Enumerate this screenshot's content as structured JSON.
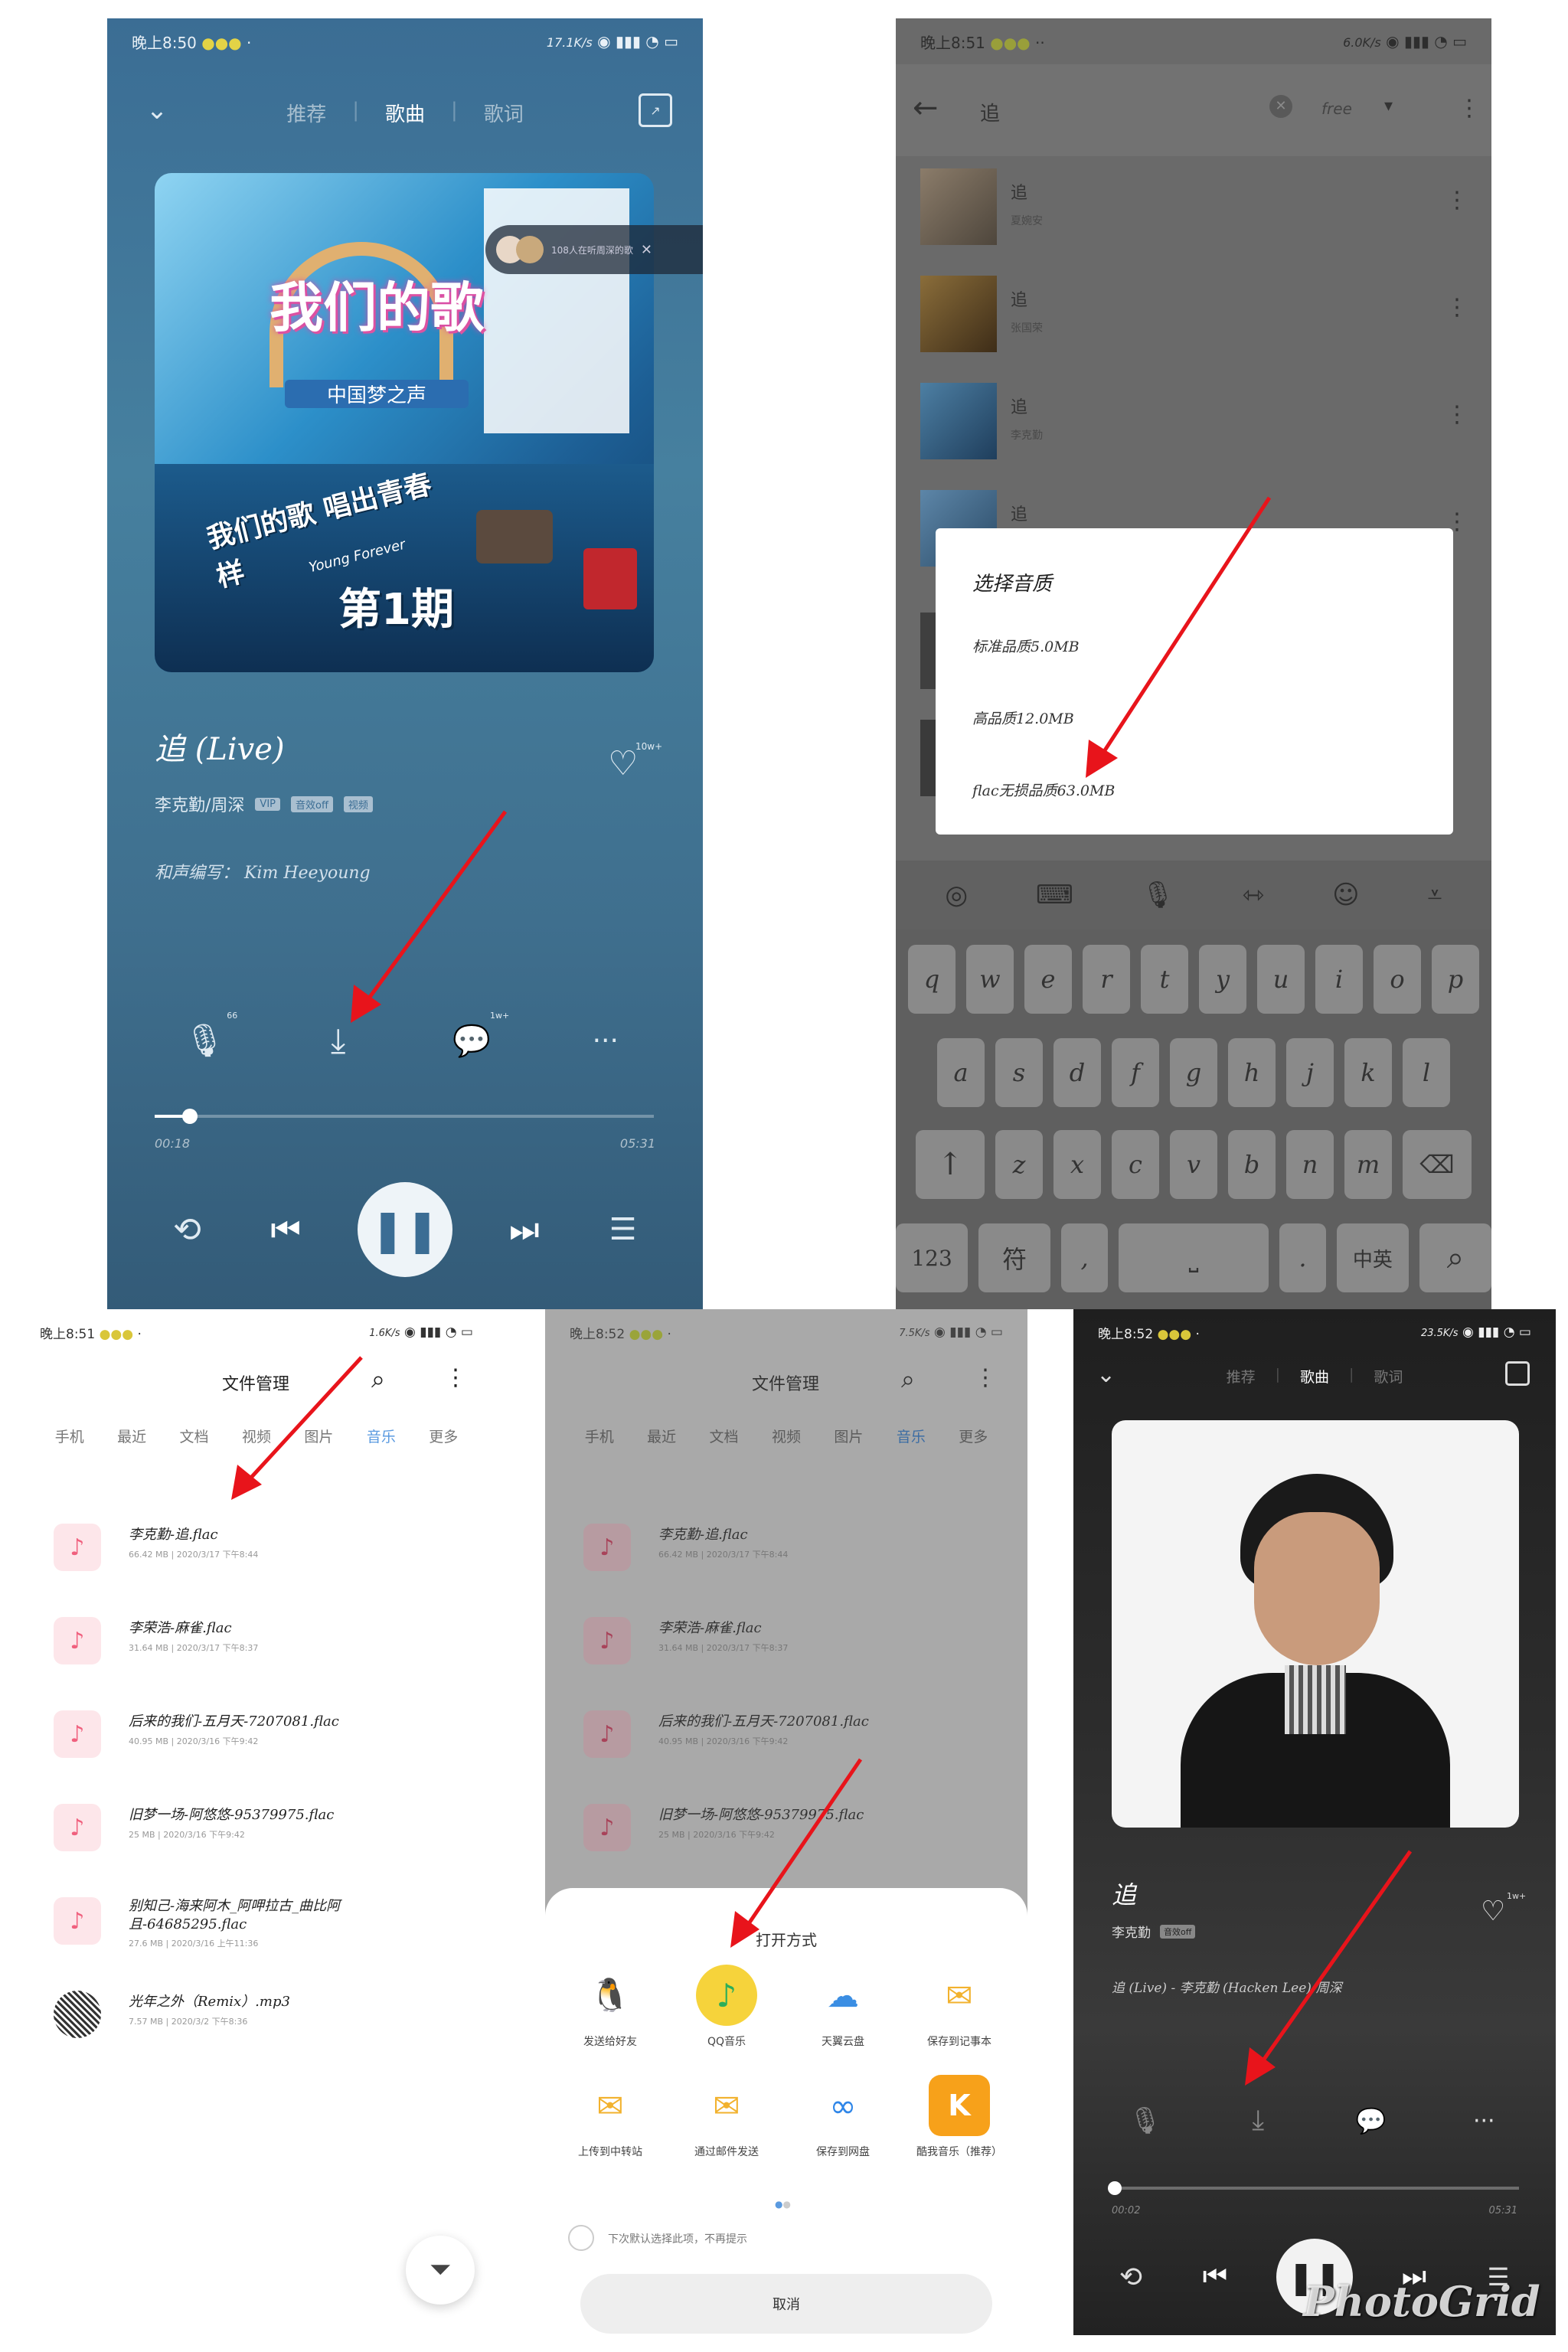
{
  "panel1": {
    "status": {
      "time": "晚上8:50",
      "net": "17.1K/s"
    },
    "tabs": [
      "推荐",
      "歌曲",
      "歌词"
    ],
    "album": {
      "line1": "我们的歌",
      "line2": "中国梦之声",
      "slogan": "我们的歌 唱出青春样",
      "slogan_en": "Young Forever",
      "episode": "第1期"
    },
    "bubble_text": "108人在听周深的歌",
    "song_title": "追 (Live)",
    "artist": "李克勤/周深",
    "badges": [
      "VIP",
      "音效off",
      "视频"
    ],
    "arranger": "和声编写： Kim Heeyoung",
    "like_count": "10w+",
    "mic_count": "66",
    "comment_count": "1w+",
    "time_elapsed": "00:18",
    "time_total": "05:31",
    "progress": 0.07
  },
  "panel2": {
    "status": {
      "time": "晚上8:51",
      "net": "6.0K/s"
    },
    "search_value": "追",
    "quality_chip": "free",
    "results": [
      {
        "title": "追",
        "artist": "夏婉安"
      },
      {
        "title": "追",
        "artist": "张国荣"
      },
      {
        "title": "追",
        "artist": "李克勤"
      },
      {
        "title": "追",
        "artist": ""
      }
    ],
    "dialog": {
      "title": "选择音质",
      "options": [
        "标准品质5.0MB",
        "高品质12.0MB",
        "flac无损品质63.0MB"
      ]
    },
    "keyboard": {
      "row1": [
        "q",
        "w",
        "e",
        "r",
        "t",
        "y",
        "u",
        "i",
        "o",
        "p"
      ],
      "row2": [
        "a",
        "s",
        "d",
        "f",
        "g",
        "h",
        "j",
        "k",
        "l"
      ],
      "row3": [
        "z",
        "x",
        "c",
        "v",
        "b",
        "n",
        "m"
      ],
      "num": "123",
      "sym": "符",
      "comma": ",",
      "period": ".",
      "lang": "中英"
    }
  },
  "panel3": {
    "status": {
      "time": "晚上8:51",
      "net": "1.6K/s"
    },
    "title": "文件管理",
    "tabs": [
      "手机",
      "最近",
      "文档",
      "视频",
      "图片",
      "音乐",
      "更多"
    ],
    "active_tab": "音乐",
    "files": [
      {
        "name": "李克勤-追.flac",
        "meta": "66.42 MB | 2020/3/17 下午8:44"
      },
      {
        "name": "李荣浩-麻雀.flac",
        "meta": "31.64 MB | 2020/3/17 下午8:37"
      },
      {
        "name": "后来的我们-五月天-7207081.flac",
        "meta": "40.95 MB | 2020/3/16 下午9:42"
      },
      {
        "name": "旧梦一场-阿悠悠-95379975.flac",
        "meta": "25 MB | 2020/3/16 下午9:42"
      },
      {
        "name": "别知己-海来阿木_阿呷拉古_曲比阿且-64685295.flac",
        "meta": "27.6 MB | 2020/3/16 上午11:36"
      },
      {
        "name": "光年之外（Remix）.mp3",
        "meta": "7.57 MB | 2020/3/2 下午8:36"
      }
    ]
  },
  "panel4": {
    "status": {
      "time": "晚上8:52",
      "net": "7.5K/s"
    },
    "title": "文件管理",
    "tabs": [
      "手机",
      "最近",
      "文档",
      "视频",
      "图片",
      "音乐",
      "更多"
    ],
    "files": [
      {
        "name": "李克勤-追.flac",
        "meta": "66.42 MB | 2020/3/17 下午8:44"
      },
      {
        "name": "李荣浩-麻雀.flac",
        "meta": "31.64 MB | 2020/3/17 下午8:37"
      },
      {
        "name": "后来的我们-五月天-7207081.flac",
        "meta": "40.95 MB | 2020/3/16 下午9:42"
      },
      {
        "name": "旧梦一场-阿悠悠-95379975.flac",
        "meta": "25 MB | 2020/3/16 下午9:42"
      }
    ],
    "sheet": {
      "title": "打开方式",
      "apps": [
        "发送给好友",
        "QQ音乐",
        "天翼云盘",
        "保存到记事本",
        "上传到中转站",
        "通过邮件发送",
        "保存到网盘",
        "酷我音乐（推荐）"
      ],
      "remember": "下次默认选择此项，不再提示",
      "cancel": "取消"
    }
  },
  "panel5": {
    "status": {
      "time": "晚上8:52",
      "net": "23.5K/s"
    },
    "tabs": [
      "推荐",
      "歌曲",
      "歌词"
    ],
    "song_title": "追",
    "artist": "李克勤",
    "badge": "音效off",
    "subtitle": "追 (Live) - 李克勤 (Hacken Lee)/周深",
    "like_count": "1w+",
    "time_elapsed": "00:02",
    "time_total": "05:31",
    "progress": 0.01,
    "watermark": "PhotoGrid"
  },
  "colors": {
    "arrow": "#e8141b",
    "accent": "#5a9ae0",
    "pink": "#f0607e"
  }
}
